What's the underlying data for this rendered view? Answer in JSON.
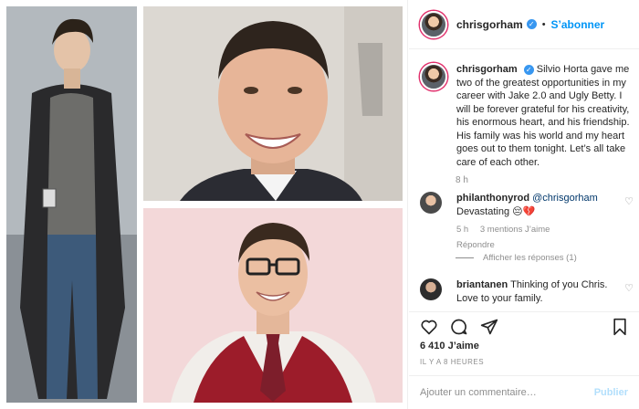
{
  "post": {
    "username": "chrisgorham",
    "follow_label": "S’abonner",
    "caption": "Silvio Horta gave me two of the greatest opportunities in my career with Jake 2.0 and Ugly Betty. I will be forever grateful for his creativity, his enormous heart, and his friendship. His family was his world and my heart goes out to them tonight. Let’s all take care of each other.",
    "caption_time": "8 h",
    "likes": "6 410 J’aime",
    "posted_ago": "IL Y A 8 HEURES"
  },
  "comments": [
    {
      "username": "philanthonyrod",
      "mention": "@chrisgorham",
      "text": "Devastating 😔💔",
      "time": "5 h",
      "likes": "3 mentions J’aime",
      "reply": "Répondre",
      "view_replies": "Afficher les réponses (1)"
    },
    {
      "username": "briantanen",
      "text": "Thinking of you Chris. Love to your family."
    }
  ],
  "add_comment": {
    "placeholder": "Ajouter un commentaire…",
    "post_label": "Publier"
  },
  "icons": {
    "verified": "✓"
  },
  "colors": {
    "accent": "#0095f6",
    "muted": "#8e8e8e",
    "mention": "#00376b"
  }
}
